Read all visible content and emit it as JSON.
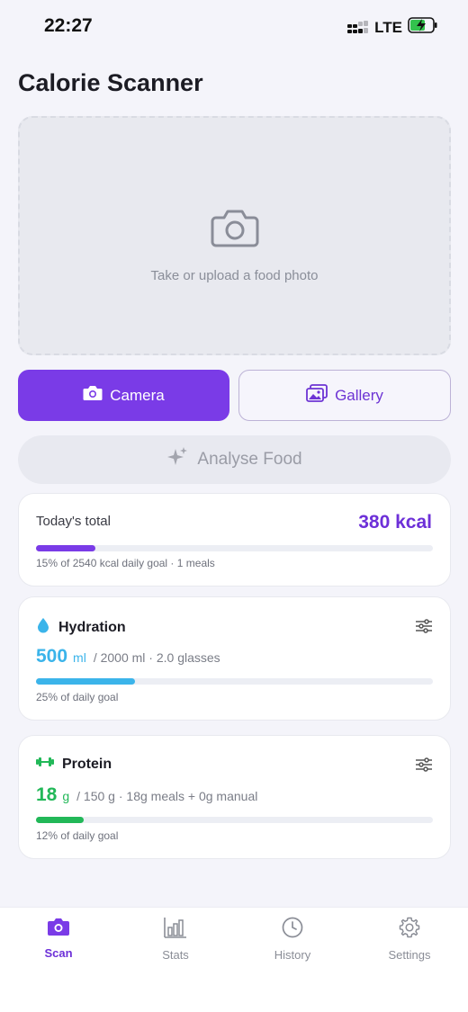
{
  "status_bar": {
    "time": "22:27",
    "network": "LTE"
  },
  "app": {
    "title": "Calorie Scanner"
  },
  "upload": {
    "prompt": "Take or upload a food photo"
  },
  "actions": {
    "camera_label": "Camera",
    "gallery_label": "Gallery",
    "analyse_label": "Analyse Food"
  },
  "today": {
    "label": "Today's total",
    "value": "380 kcal",
    "progress": 0.15,
    "summary": "15% of 2540 kcal daily goal · 1 meals"
  },
  "hydration": {
    "title": "Hydration",
    "value": "500",
    "unit": "ml",
    "detail": "/ 2000 ml · 2.0 glasses",
    "progress": 0.25,
    "goal_text": "25% of daily goal",
    "color": "#3bb4ea"
  },
  "protein": {
    "title": "Protein",
    "value": "18",
    "unit": "g",
    "detail": "/ 150 g · 18g meals + 0g manual",
    "progress": 0.12,
    "goal_text": "12% of daily goal",
    "color": "#22b858"
  },
  "tabs": [
    {
      "label": "Scan",
      "icon": "camera-icon",
      "active": true
    },
    {
      "label": "Stats",
      "icon": "bar-chart-icon",
      "active": false
    },
    {
      "label": "History",
      "icon": "clock-icon",
      "active": false
    },
    {
      "label": "Settings",
      "icon": "gear-icon",
      "active": false
    }
  ],
  "colors": {
    "accent": "#7a3be7",
    "accent_text": "#6d30d8",
    "background": "#f4f4fa"
  }
}
